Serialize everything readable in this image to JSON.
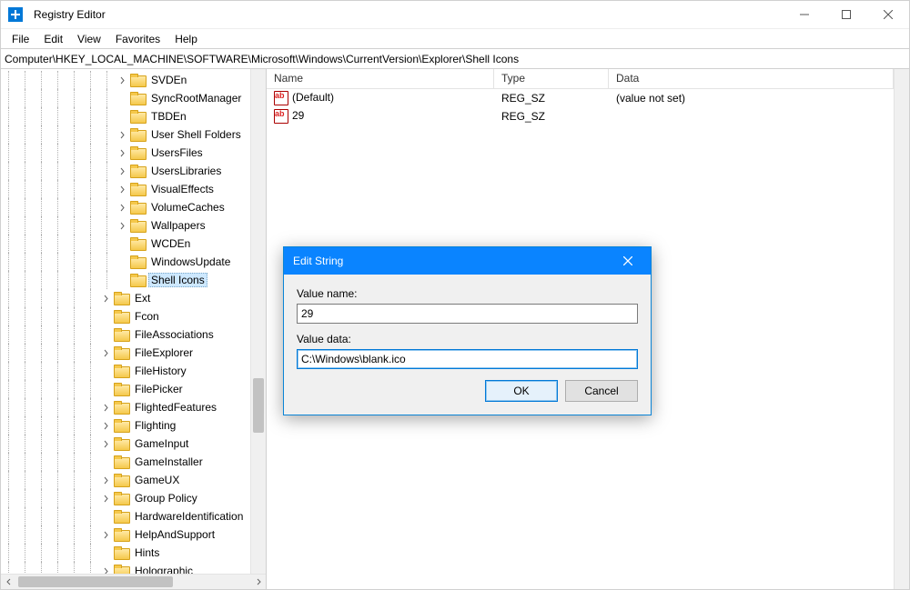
{
  "app": {
    "title": "Registry Editor"
  },
  "menu": {
    "items": [
      "File",
      "Edit",
      "View",
      "Favorites",
      "Help"
    ]
  },
  "address": "Computer\\HKEY_LOCAL_MACHINE\\SOFTWARE\\Microsoft\\Windows\\CurrentVersion\\Explorer\\Shell Icons",
  "tree": {
    "depth_base": 7,
    "items": [
      {
        "label": "SVDEn",
        "expandable": true,
        "depth": 7
      },
      {
        "label": "SyncRootManager",
        "expandable": false,
        "depth": 7
      },
      {
        "label": "TBDEn",
        "expandable": false,
        "depth": 7
      },
      {
        "label": "User Shell Folders",
        "expandable": true,
        "depth": 7
      },
      {
        "label": "UsersFiles",
        "expandable": true,
        "depth": 7
      },
      {
        "label": "UsersLibraries",
        "expandable": true,
        "depth": 7
      },
      {
        "label": "VisualEffects",
        "expandable": true,
        "depth": 7
      },
      {
        "label": "VolumeCaches",
        "expandable": true,
        "depth": 7
      },
      {
        "label": "Wallpapers",
        "expandable": true,
        "depth": 7
      },
      {
        "label": "WCDEn",
        "expandable": false,
        "depth": 7
      },
      {
        "label": "WindowsUpdate",
        "expandable": false,
        "depth": 7
      },
      {
        "label": "Shell Icons",
        "expandable": false,
        "depth": 7,
        "selected": true
      },
      {
        "label": "Ext",
        "expandable": true,
        "depth": 6
      },
      {
        "label": "Fcon",
        "expandable": false,
        "depth": 6
      },
      {
        "label": "FileAssociations",
        "expandable": false,
        "depth": 6
      },
      {
        "label": "FileExplorer",
        "expandable": true,
        "depth": 6
      },
      {
        "label": "FileHistory",
        "expandable": false,
        "depth": 6
      },
      {
        "label": "FilePicker",
        "expandable": false,
        "depth": 6
      },
      {
        "label": "FlightedFeatures",
        "expandable": true,
        "depth": 6
      },
      {
        "label": "Flighting",
        "expandable": true,
        "depth": 6
      },
      {
        "label": "GameInput",
        "expandable": true,
        "depth": 6
      },
      {
        "label": "GameInstaller",
        "expandable": false,
        "depth": 6
      },
      {
        "label": "GameUX",
        "expandable": true,
        "depth": 6
      },
      {
        "label": "Group Policy",
        "expandable": true,
        "depth": 6
      },
      {
        "label": "HardwareIdentification",
        "expandable": false,
        "depth": 6
      },
      {
        "label": "HelpAndSupport",
        "expandable": true,
        "depth": 6
      },
      {
        "label": "Hints",
        "expandable": false,
        "depth": 6
      },
      {
        "label": "Holographic",
        "expandable": true,
        "depth": 6
      }
    ]
  },
  "list": {
    "columns": {
      "name": "Name",
      "type": "Type",
      "data": "Data"
    },
    "rows": [
      {
        "name": "(Default)",
        "type": "REG_SZ",
        "data": "(value not set)"
      },
      {
        "name": "29",
        "type": "REG_SZ",
        "data": ""
      }
    ]
  },
  "dialog": {
    "title": "Edit String",
    "label_name": "Value name:",
    "value_name": "29",
    "label_data": "Value data:",
    "value_data": "C:\\Windows\\blank.ico",
    "ok": "OK",
    "cancel": "Cancel"
  }
}
